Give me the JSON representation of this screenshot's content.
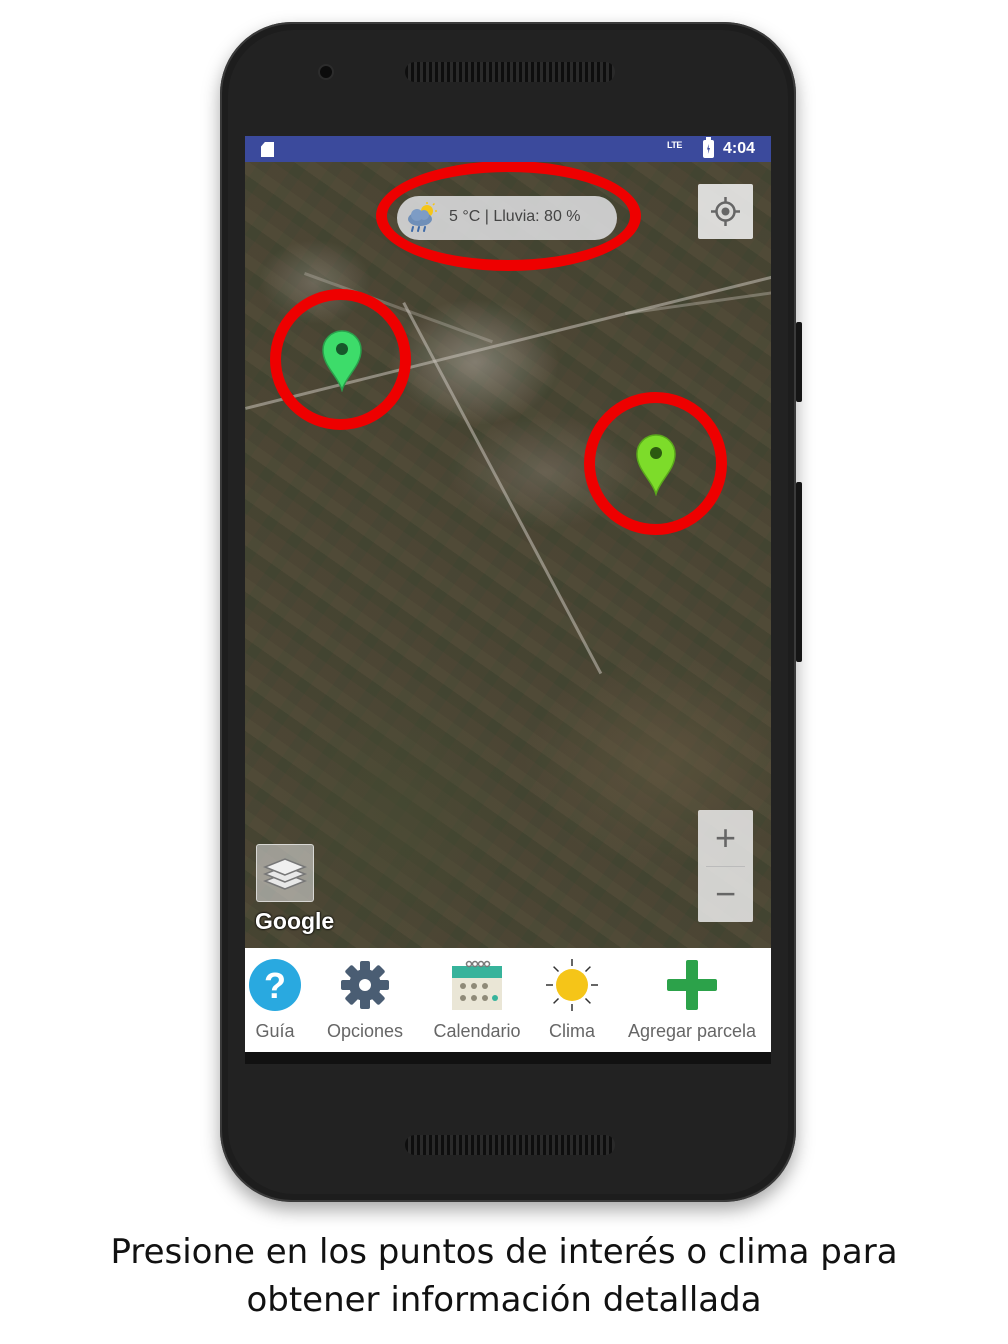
{
  "status_bar": {
    "network": "LTE",
    "time": "4:04"
  },
  "weather": {
    "text": "5 °C | Lluvia: 80 %",
    "icon": "cloud-rain-sun-icon"
  },
  "map": {
    "attribution": "Google",
    "zoom_in": "+",
    "zoom_out": "−"
  },
  "markers": [
    {
      "name": "marker-1",
      "color": "#3ddc6a"
    },
    {
      "name": "marker-2",
      "color": "#7ddc2a"
    }
  ],
  "highlight_color": "#ee0000",
  "bottom_nav": [
    {
      "label": "Guía",
      "icon": "help-icon",
      "color": "#29a9e0"
    },
    {
      "label": "Opciones",
      "icon": "gear-icon",
      "color": "#4a5d73"
    },
    {
      "label": "Calendario",
      "icon": "calendar-icon",
      "color": "#37b39b"
    },
    {
      "label": "Clima",
      "icon": "sun-icon",
      "color": "#f5c518"
    },
    {
      "label": "Agregar parcela",
      "icon": "plus-icon",
      "color": "#2ca24a"
    }
  ],
  "caption": {
    "line1": "Presione en los puntos de interés o clima para",
    "line2": "obtener información detallada"
  }
}
